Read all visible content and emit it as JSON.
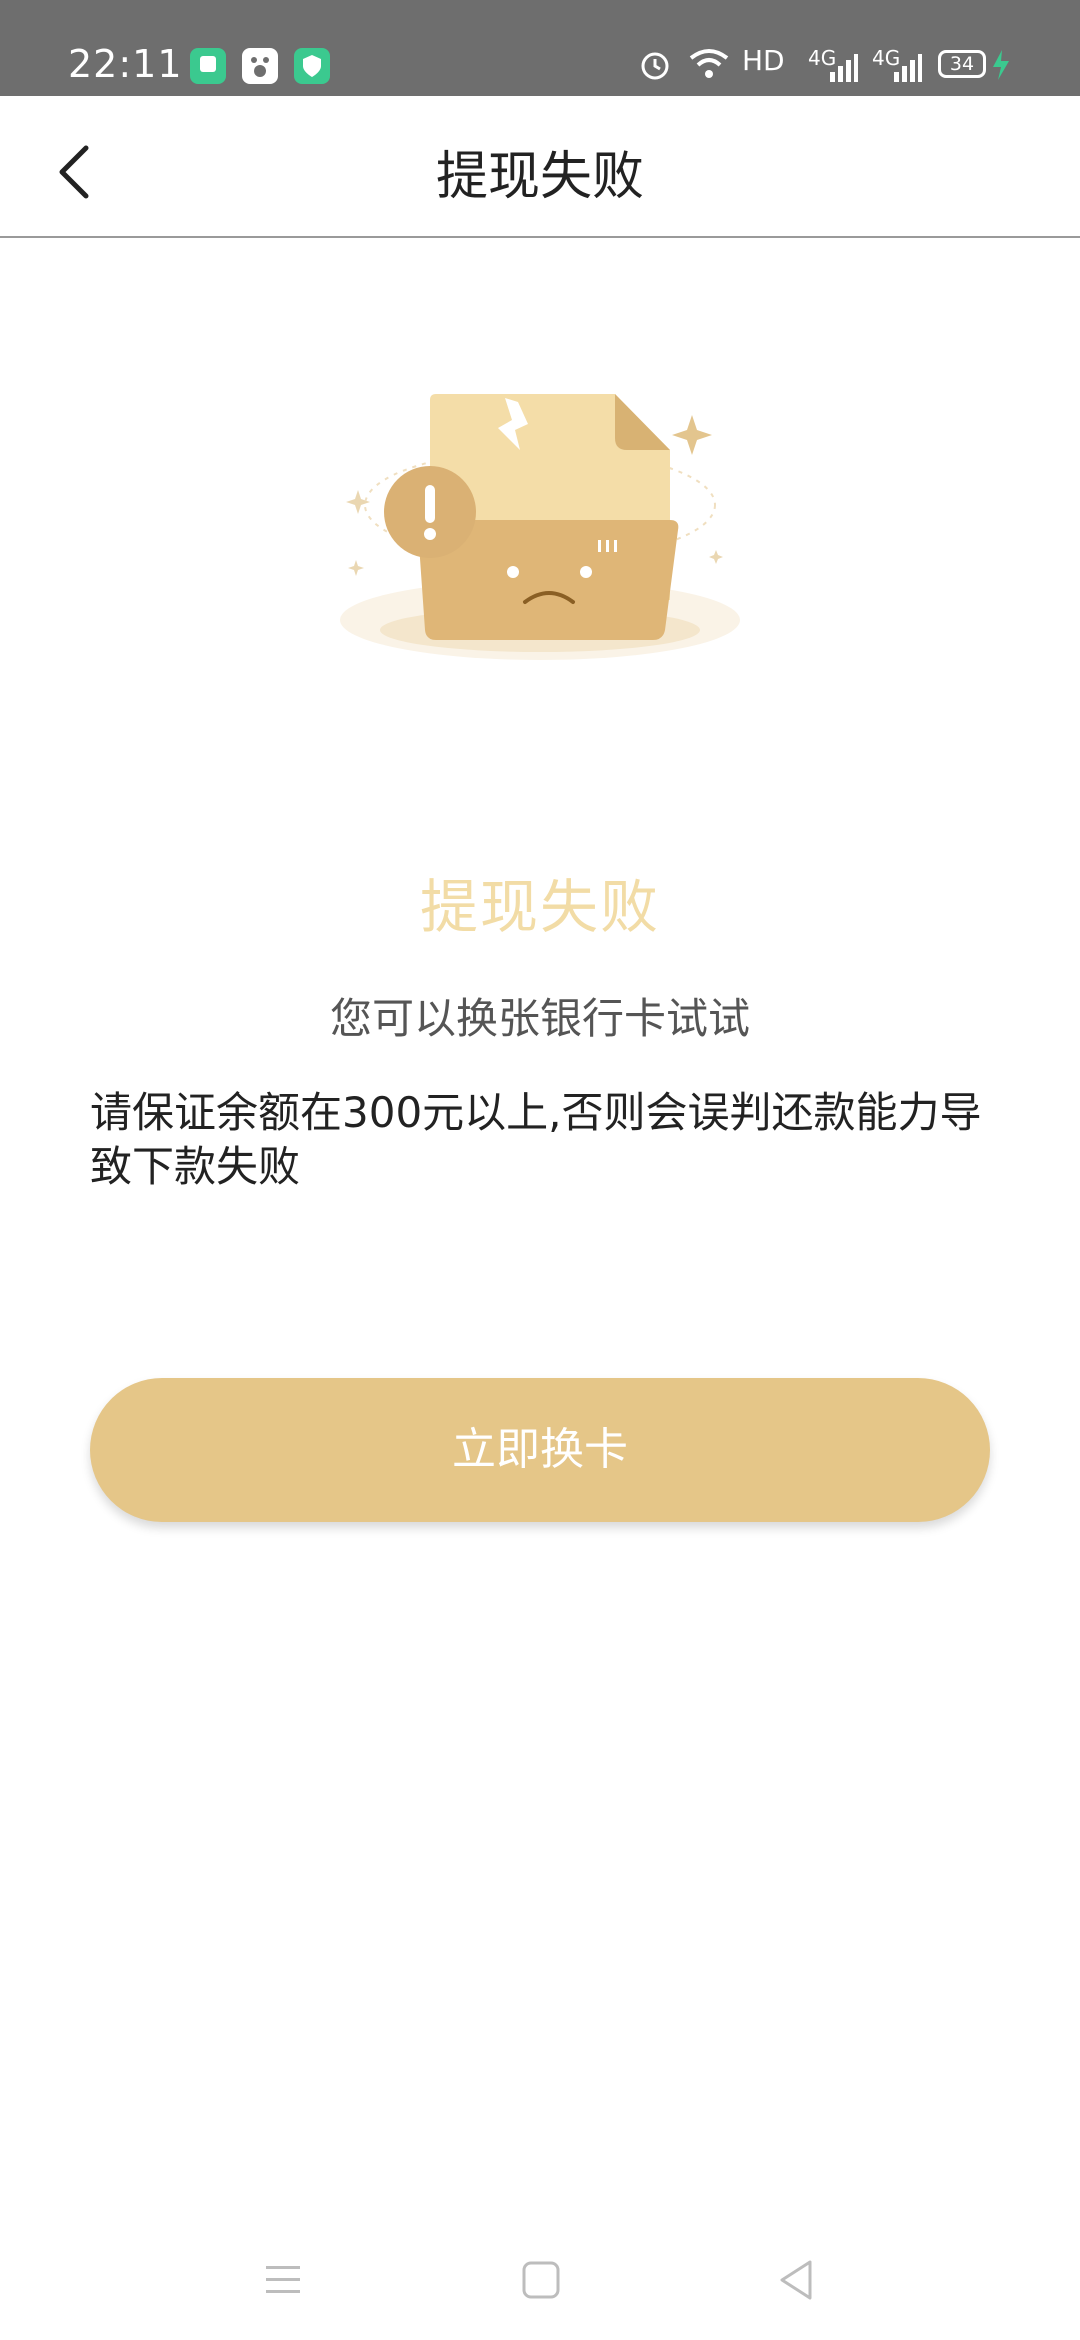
{
  "status_bar": {
    "time": "22:11",
    "network": "HD",
    "signal_1": "4G",
    "signal_2": "4G",
    "battery": "34",
    "icons": [
      "stacked-app-icon",
      "baidu-icon",
      "shield-icon",
      "alarm-icon",
      "wifi-icon",
      "signal-icon",
      "battery-icon",
      "charging-icon"
    ],
    "colors": {
      "bg": "#6e6e6e",
      "app_green": "#3bc98f"
    }
  },
  "header": {
    "title": "提现失败",
    "back_icon": "chevron-left-icon"
  },
  "main": {
    "illustration": "sad-folder-illustration",
    "fail_title": "提现失败",
    "fail_subtitle": "您可以换张银行卡试试",
    "notice": "请保证余额在300元以上,否则会误判还款能力导致下款失败",
    "button_label": "立即换卡"
  },
  "nav_bar": {
    "icons": [
      "menu-icon",
      "home-icon",
      "back-icon"
    ]
  },
  "colors": {
    "accent": "#e5c688",
    "title_light": "#f2dca6"
  }
}
